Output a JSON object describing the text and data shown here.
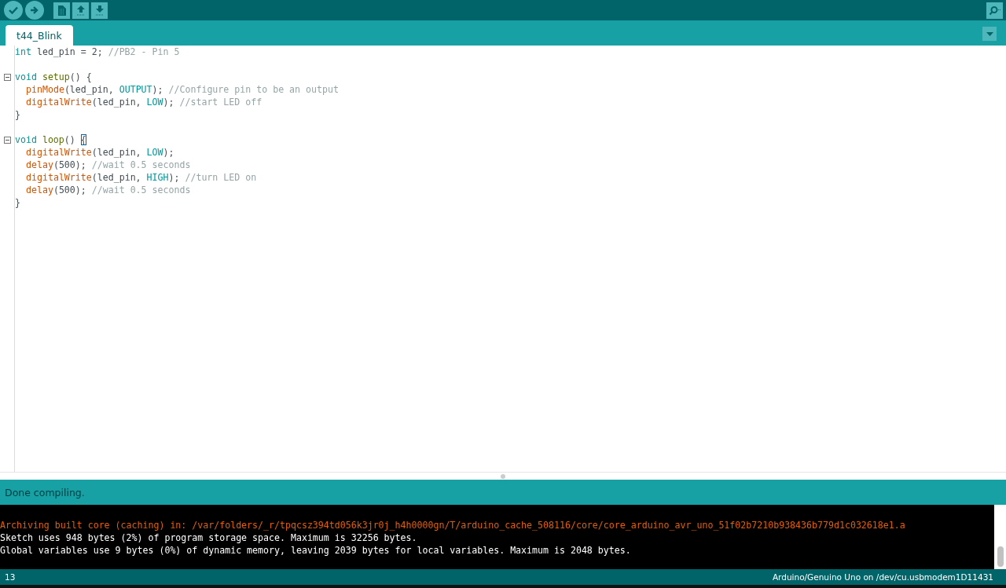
{
  "toolbar": {
    "buttons": [
      {
        "kind": "verify"
      },
      {
        "kind": "upload"
      },
      {
        "kind": "new"
      },
      {
        "kind": "open"
      },
      {
        "kind": "save"
      }
    ],
    "serial_monitor": {
      "kind": "serial"
    }
  },
  "tabs": [
    {
      "label": "t44_Blink",
      "selected": true
    }
  ],
  "editor": {
    "lines": [
      {
        "foldable": false,
        "gap_before": false,
        "indent": false,
        "tokens": [
          {
            "kind": "type",
            "text": "int "
          },
          {
            "kind": "plain",
            "text": "led_pin = 2; "
          },
          {
            "kind": "comment",
            "text": "//PB2 - Pin 5"
          }
        ]
      },
      {
        "foldable": true,
        "gap_before": true,
        "indent": false,
        "tokens": [
          {
            "kind": "type",
            "text": "void "
          },
          {
            "kind": "func",
            "text": "setup"
          },
          {
            "kind": "plain",
            "text": "() {"
          }
        ]
      },
      {
        "foldable": false,
        "gap_before": false,
        "indent": true,
        "tokens": [
          {
            "kind": "builtin",
            "text": "pinMode"
          },
          {
            "kind": "plain",
            "text": "(led_pin, "
          },
          {
            "kind": "const",
            "text": "OUTPUT"
          },
          {
            "kind": "plain",
            "text": "); "
          },
          {
            "kind": "comment",
            "text": "//Configure pin to be an output"
          }
        ]
      },
      {
        "foldable": false,
        "gap_before": false,
        "indent": true,
        "tokens": [
          {
            "kind": "builtin",
            "text": "digitalWrite"
          },
          {
            "kind": "plain",
            "text": "(led_pin, "
          },
          {
            "kind": "const",
            "text": "LOW"
          },
          {
            "kind": "plain",
            "text": "); "
          },
          {
            "kind": "comment",
            "text": "//start LED off"
          }
        ]
      },
      {
        "foldable": false,
        "gap_before": false,
        "indent": false,
        "tokens": [
          {
            "kind": "plain",
            "text": "}"
          }
        ]
      },
      {
        "foldable": true,
        "gap_before": true,
        "indent": false,
        "tokens": [
          {
            "kind": "type",
            "text": "void "
          },
          {
            "kind": "func",
            "text": "loop"
          },
          {
            "kind": "plain",
            "text": "() "
          },
          {
            "kind": "bracket",
            "text": "{"
          }
        ]
      },
      {
        "foldable": false,
        "gap_before": false,
        "indent": true,
        "tokens": [
          {
            "kind": "builtin",
            "text": "digitalWrite"
          },
          {
            "kind": "plain",
            "text": "(led_pin, "
          },
          {
            "kind": "const",
            "text": "LOW"
          },
          {
            "kind": "plain",
            "text": ");"
          }
        ]
      },
      {
        "foldable": false,
        "gap_before": false,
        "indent": true,
        "tokens": [
          {
            "kind": "builtin",
            "text": "delay"
          },
          {
            "kind": "plain",
            "text": "(500); "
          },
          {
            "kind": "comment",
            "text": "//wait 0.5 seconds"
          }
        ]
      },
      {
        "foldable": false,
        "gap_before": false,
        "indent": true,
        "tokens": [
          {
            "kind": "builtin",
            "text": "digitalWrite"
          },
          {
            "kind": "plain",
            "text": "(led_pin, "
          },
          {
            "kind": "const",
            "text": "HIGH"
          },
          {
            "kind": "plain",
            "text": "); "
          },
          {
            "kind": "comment",
            "text": "//turn LED on"
          }
        ]
      },
      {
        "foldable": false,
        "gap_before": false,
        "indent": true,
        "tokens": [
          {
            "kind": "builtin",
            "text": "delay"
          },
          {
            "kind": "plain",
            "text": "(500); "
          },
          {
            "kind": "comment",
            "text": "//wait 0.5 seconds"
          }
        ]
      },
      {
        "foldable": false,
        "gap_before": false,
        "indent": false,
        "tokens": [
          {
            "kind": "plain",
            "text": "}"
          }
        ]
      }
    ]
  },
  "message": "Done compiling.",
  "console": [
    {
      "kind": "warning",
      "text": "Archiving built core (caching) in: /var/folders/_r/tpqcsz394td056k3jr0j_h4h0000gn/T/arduino_cache_508116/core/core_arduino_avr_uno_51f02b7210b938436b779d1c032618e1.a"
    },
    {
      "kind": "info",
      "text": "Sketch uses 948 bytes (2%) of program storage space. Maximum is 32256 bytes."
    },
    {
      "kind": "info",
      "text": "Global variables use 9 bytes (0%) of dynamic memory, leaving 2039 bytes for local variables. Maximum is 2048 bytes."
    }
  ],
  "status_bar": {
    "line": "13",
    "board": "Arduino/Genuino Uno on /dev/cu.usbmodem1D11431"
  }
}
